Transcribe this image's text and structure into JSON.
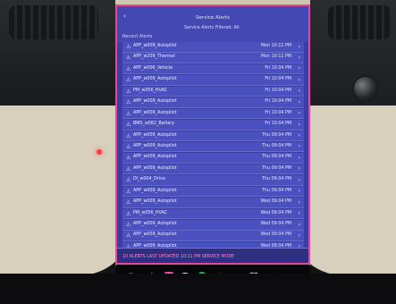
{
  "screen": {
    "title": "Service Alerts",
    "subinfo": "Service Alerts   Filtered: All",
    "section_label": "Recent Alerts",
    "back_icon": "chevron-left-icon",
    "rows": [
      {
        "name": "APP_w009_Autopilot",
        "meta": "Mon 10:11 PM"
      },
      {
        "name": "APP_w209_Thermal",
        "meta": "Mon 10:11 PM"
      },
      {
        "name": "APP_w006_Vehicle",
        "meta": "Fri 10:04 PM"
      },
      {
        "name": "APP_w009_Autopilot",
        "meta": "Fri 10:04 PM"
      },
      {
        "name": "PM_w056_HVAC",
        "meta": "Fri 10:04 PM"
      },
      {
        "name": "APP_w009_Autopilot",
        "meta": "Fri 10:04 PM"
      },
      {
        "name": "APP_w009_Autopilot",
        "meta": "Fri 10:04 PM"
      },
      {
        "name": "BMS_w082_Battery",
        "meta": "Fri 10:04 PM"
      },
      {
        "name": "APP_w009_Autopilot",
        "meta": "Thu 09:04 PM"
      },
      {
        "name": "APP_w009_Autopilot",
        "meta": "Thu 09:04 PM"
      },
      {
        "name": "APP_w009_Autopilot",
        "meta": "Thu 09:04 PM"
      },
      {
        "name": "APP_w009_Autopilot",
        "meta": "Thu 09:04 PM"
      },
      {
        "name": "DI_w004_Drive",
        "meta": "Thu 09:04 PM"
      },
      {
        "name": "APP_w009_Autopilot",
        "meta": "Thu 09:04 PM"
      },
      {
        "name": "APP_w009_Autopilot",
        "meta": "Wed 09:04 PM"
      },
      {
        "name": "PM_w056_HVAC",
        "meta": "Wed 09:04 PM"
      },
      {
        "name": "APP_w009_Autopilot",
        "meta": "Wed 09:04 PM"
      },
      {
        "name": "APP_w009_Autopilot",
        "meta": "Wed 09:04 PM"
      },
      {
        "name": "APP_w009_Autopilot",
        "meta": "Wed 09:04 PM"
      }
    ],
    "bottom_alert": "10 ALERTS   LAST UPDATED 10:11 PM   SERVICE MODE"
  },
  "dock": {
    "icons": [
      "car-icon",
      "climate-icon",
      "media-icon",
      "phone-icon",
      "maps-icon",
      "energy-icon",
      "apps-icon",
      "camera-icon",
      "volume-icon"
    ]
  },
  "colors": {
    "screen_bg": "#3c3ea6",
    "accent_pink": "#e9459b"
  }
}
